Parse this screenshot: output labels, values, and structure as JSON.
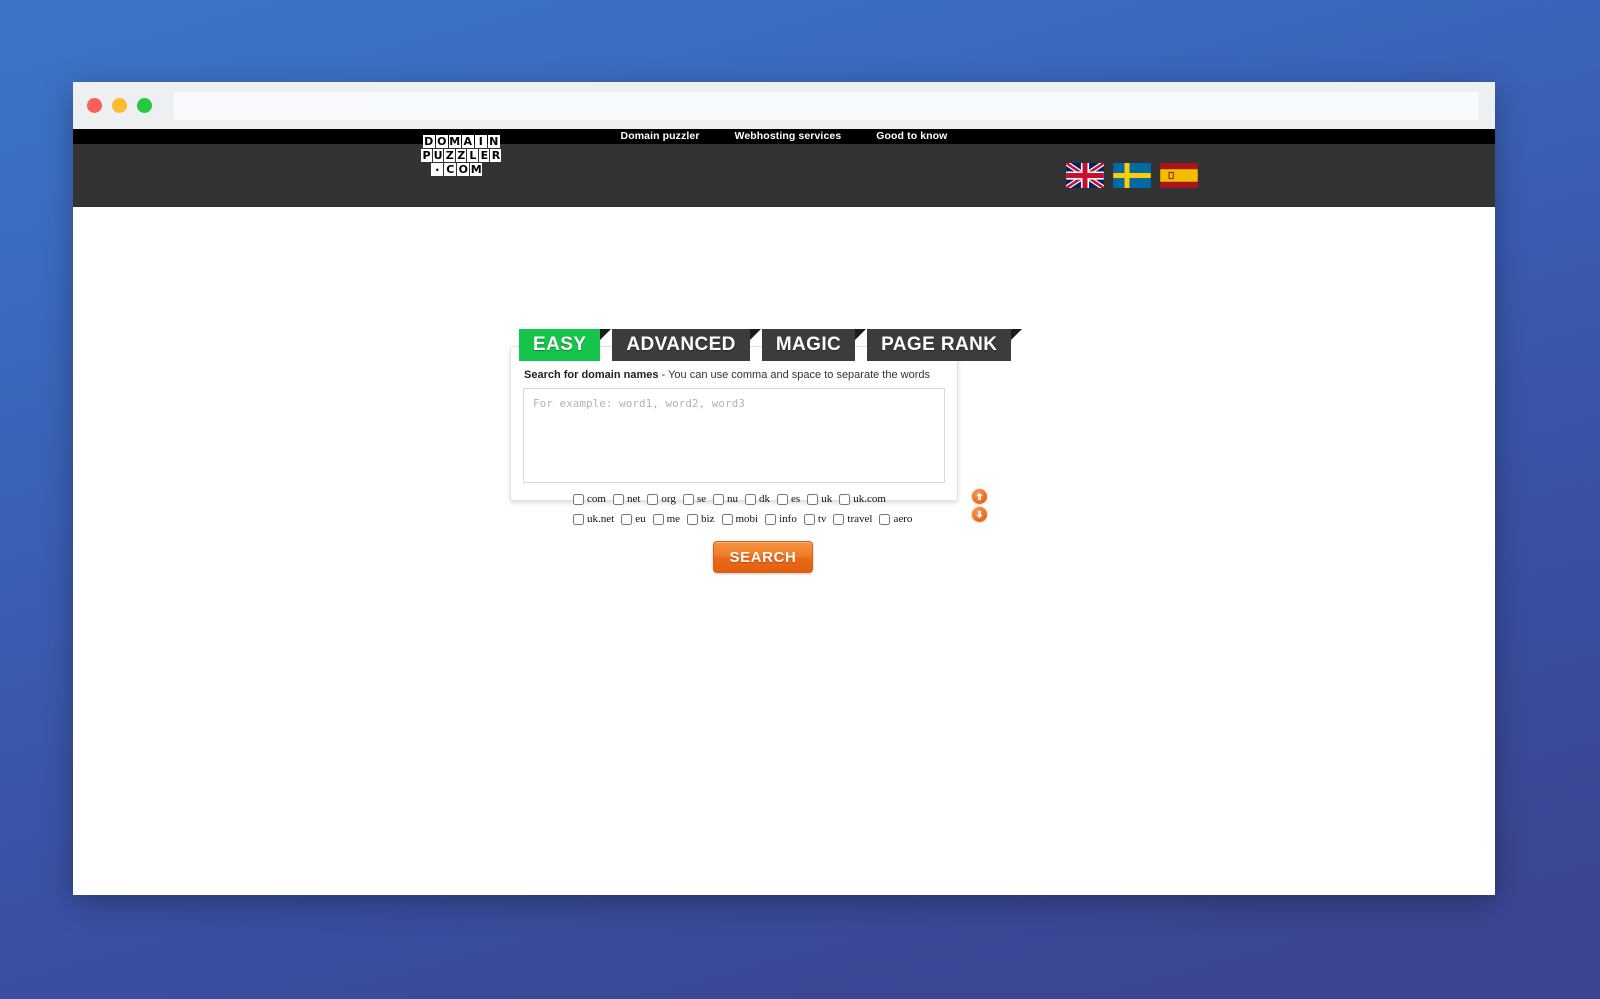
{
  "window": {
    "traffic_lights": [
      "close",
      "minimize",
      "zoom"
    ],
    "url_value": "",
    "url_placeholder": ""
  },
  "topnav": {
    "items": [
      {
        "label": "Domain puzzler"
      },
      {
        "label": "Webhosting services"
      },
      {
        "label": "Good to know"
      }
    ]
  },
  "header": {
    "logo": {
      "line1": [
        "D",
        "O",
        "M",
        "A",
        "I",
        "N"
      ],
      "line2": [
        "P",
        "U",
        "Z",
        "Z",
        "L",
        "E",
        "R"
      ],
      "line3": [
        ".",
        "C",
        "O",
        "M"
      ],
      "alt": "DOMAINPUZZLER.COM"
    },
    "flags": [
      {
        "name": "flag-uk",
        "title": "English"
      },
      {
        "name": "flag-sweden",
        "title": "Svenska"
      },
      {
        "name": "flag-spain",
        "title": "Espanol"
      }
    ]
  },
  "tabs": [
    {
      "label": "EASY",
      "active": true
    },
    {
      "label": "ADVANCED",
      "active": false
    },
    {
      "label": "MAGIC",
      "active": false
    },
    {
      "label": "PAGE RANK",
      "active": false
    }
  ],
  "panel": {
    "label_bold": "Search for domain names",
    "label_rest": " - You can use comma and space to separate the words",
    "textarea_value": "",
    "textarea_placeholder": "For example: word1, word2, word3"
  },
  "tlds": {
    "row1": [
      {
        "label": "com",
        "checked": false
      },
      {
        "label": "net",
        "checked": false
      },
      {
        "label": "org",
        "checked": false
      },
      {
        "label": "se",
        "checked": false
      },
      {
        "label": "nu",
        "checked": false
      },
      {
        "label": "dk",
        "checked": false
      },
      {
        "label": "es",
        "checked": false
      },
      {
        "label": "uk",
        "checked": false
      },
      {
        "label": "uk.com",
        "checked": false
      }
    ],
    "row2": [
      {
        "label": "uk.net",
        "checked": false
      },
      {
        "label": "eu",
        "checked": false
      },
      {
        "label": "me",
        "checked": false
      },
      {
        "label": "biz",
        "checked": false
      },
      {
        "label": "mobi",
        "checked": false
      },
      {
        "label": "info",
        "checked": false
      },
      {
        "label": "tv",
        "checked": false
      },
      {
        "label": "travel",
        "checked": false
      },
      {
        "label": "aero",
        "checked": false
      }
    ]
  },
  "arrows": [
    {
      "name": "scroll-up-icon"
    },
    {
      "name": "scroll-down-icon"
    }
  ],
  "search_button": {
    "label": "SEARCH"
  },
  "colors": {
    "desktop_top": "#3d74c8",
    "desktop_bottom": "#3c4390",
    "topnav_bg": "#000000",
    "header_bg": "#333333",
    "tab_active": "#15c54b",
    "tab_inactive": "#3c3c3c",
    "accent_orange": "#ee7326",
    "search_button": "#ea6a18"
  }
}
